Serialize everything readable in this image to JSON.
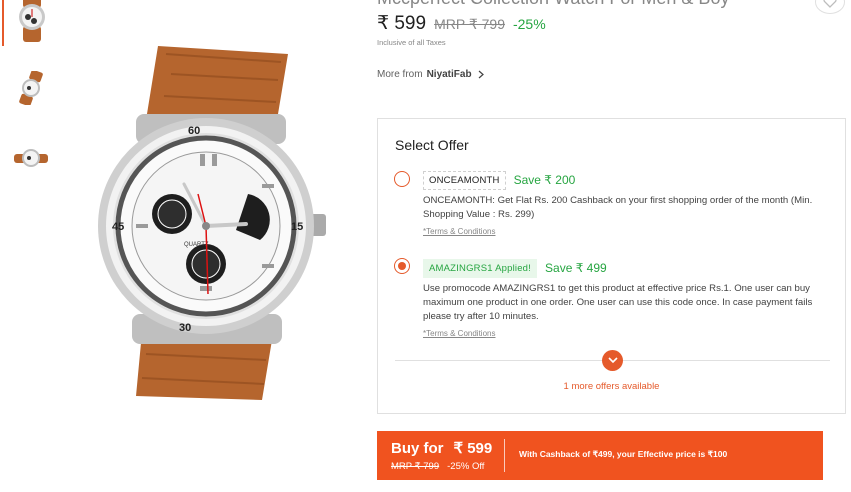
{
  "product": {
    "title": "Mccperfect Collection Watch For Men & Boy",
    "price": "₹ 599",
    "mrp": "MRP ₹ 799",
    "discount": "-25%",
    "taxes_note": "Inclusive of all Taxes",
    "more_from_label": "More from",
    "seller": "NiyatiFab"
  },
  "offers": {
    "title": "Select Offer",
    "items": [
      {
        "code": "ONCEAMONTH",
        "save": "Save ₹ 200",
        "description": "ONCEAMONTH: Get Flat Rs. 200 Cashback on your first shopping order of the month (Min. Shopping Value : Rs. 299)",
        "terms": "*Terms & Conditions",
        "selected": false
      },
      {
        "code": "AMAZINGRS1 Applied!",
        "save": "Save ₹ 499",
        "description": "Use promocode AMAZINGRS1 to get this product at effective price Rs.1. One user can buy maximum one product in one order. One user can use this code once. In case payment fails please try after 10 minutes.",
        "terms": "*Terms & Conditions",
        "selected": true
      }
    ],
    "more_text": "1 more offers available"
  },
  "buy": {
    "label": "Buy for",
    "price": "₹ 599",
    "mrp": "MRP ₹ 799",
    "discount": "-25% Off",
    "cashback_text": "With Cashback of ₹499, your Effective price is ₹100"
  },
  "colors": {
    "accent": "#e55a2b",
    "buy_bar": "#f0531f",
    "green": "#26a541",
    "strap": "#b5652e"
  },
  "icons": [
    "watch-thumbnail",
    "heart-icon",
    "chevron-right-icon",
    "chevron-down-icon"
  ]
}
